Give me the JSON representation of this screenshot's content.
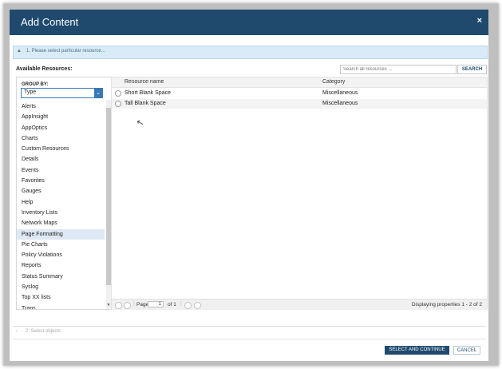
{
  "dialog": {
    "title": "Add Content",
    "close_symbol": "×"
  },
  "step1": {
    "label": "1. Please select particular resource...",
    "arrow": "▲"
  },
  "available_label": "Available Resources:",
  "search": {
    "placeholder": "Search all resources ...",
    "button_label": "SEARCH"
  },
  "group_by": {
    "label": "GROUP BY:",
    "selected": "Type",
    "dropdown_symbol": "⌄"
  },
  "categories": [
    "Alerts",
    "AppInsight",
    "AppOptics",
    "Charts",
    "Custom Resources",
    "Details",
    "Events",
    "Favorites",
    "Gauges",
    "Help",
    "Inventory Lists",
    "Network Maps",
    "Page Formatting",
    "Pie Charts",
    "Policy Violations",
    "Reports",
    "Status Summary",
    "Syslog",
    "Top XX lists",
    "Traps"
  ],
  "selected_category": "Page Formatting",
  "grid": {
    "columns": {
      "name": "Resource name",
      "category": "Category"
    },
    "rows": [
      {
        "name": "Short Blank Space",
        "category": "Miscellaneous"
      },
      {
        "name": "Tall Blank Space",
        "category": "Miscellaneous"
      }
    ]
  },
  "pager": {
    "page_label": "Page",
    "page_value": "1",
    "of_label": "of 1",
    "status": "Displaying properties 1 - 2 of 2"
  },
  "step2": {
    "label": "2. Select objects",
    "arrow": "›"
  },
  "buttons": {
    "primary": "SELECT AND CONTINUE",
    "cancel": "CANCEL"
  },
  "colors": {
    "titlebar": "#1f4a6e",
    "step_active_bg": "#d9ebf7",
    "accent": "#3a78b5"
  }
}
